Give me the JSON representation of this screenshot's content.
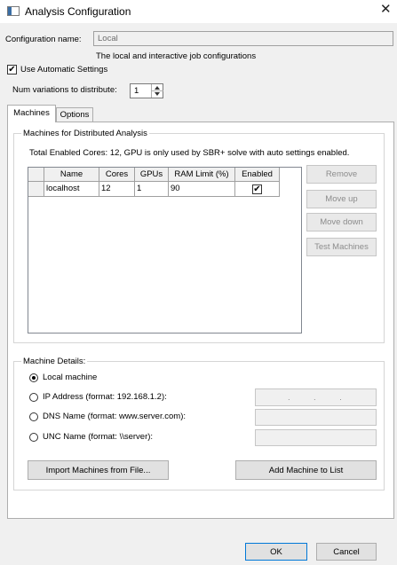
{
  "window": {
    "title": "Analysis Configuration",
    "close_glyph": "✕",
    "icon": "window-icon"
  },
  "config": {
    "name_label": "Configuration name:",
    "name_value": "Local",
    "description": "The local and interactive job configurations"
  },
  "auto_settings": {
    "label": "Use Automatic Settings",
    "checked": true,
    "check_glyph": "✔"
  },
  "variations": {
    "label": "Num variations to distribute:",
    "value": "1"
  },
  "tabs": [
    {
      "label": "Machines",
      "active": true
    },
    {
      "label": "Options",
      "active": false
    }
  ],
  "machines_group": {
    "title": "Machines for Distributed Analysis",
    "info": "Total Enabled Cores: 12, GPU is only used by SBR+ solve with auto settings enabled.",
    "columns": [
      "Name",
      "Cores",
      "GPUs",
      "RAM Limit (%)",
      "Enabled"
    ],
    "rows": [
      {
        "name": "localhost",
        "cores": "12",
        "gpus": "1",
        "ram": "90",
        "enabled": true,
        "enabled_glyph": "✔"
      }
    ],
    "buttons": {
      "remove": "Remove",
      "move_up": "Move up",
      "move_down": "Move down",
      "test": "Test Machines"
    }
  },
  "details_group": {
    "title": "Machine Details:",
    "options": [
      {
        "label": "Local machine",
        "selected": true
      },
      {
        "label": "IP Address (format: 192.168.1.2):",
        "selected": false
      },
      {
        "label": "DNS Name (format: www.server.com):",
        "selected": false
      },
      {
        "label": "UNC Name (format: \\\\server):",
        "selected": false
      }
    ],
    "ip_dots": ".          .          .",
    "import_button": "Import Machines from File...",
    "add_button": "Add Machine to List"
  },
  "footer": {
    "ok": "OK",
    "cancel": "Cancel"
  },
  "colors": {
    "accent": "#0078d7",
    "window_bg": "#f0f0f0"
  }
}
